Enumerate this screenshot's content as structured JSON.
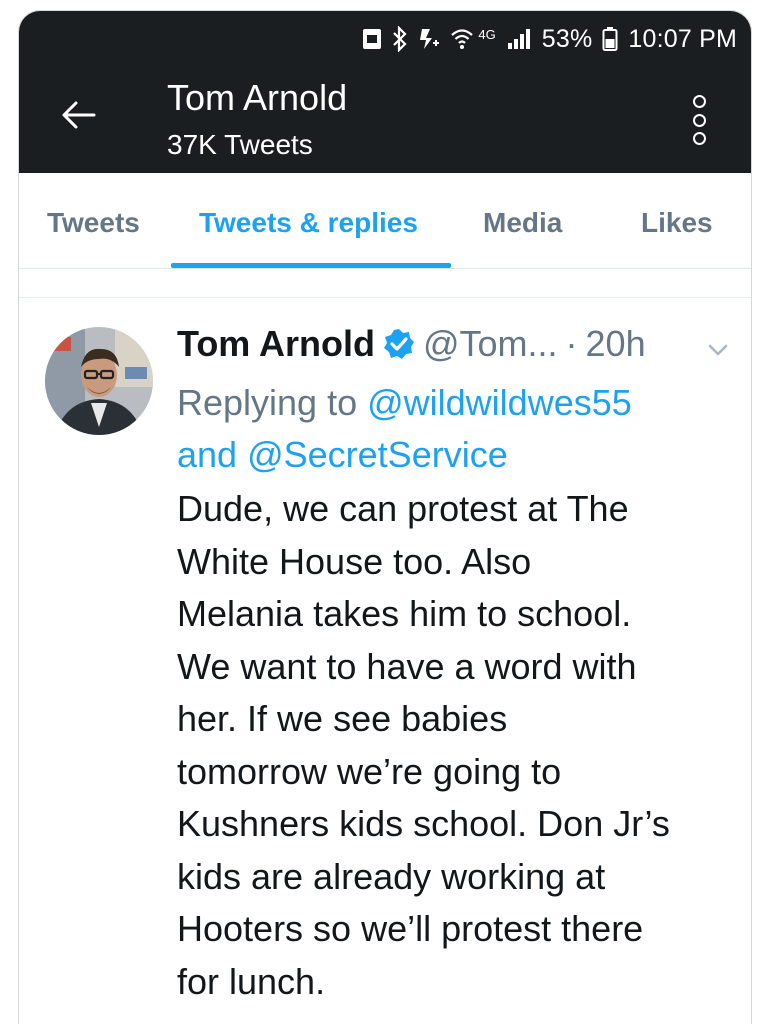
{
  "status_bar": {
    "battery_percent": "53%",
    "time": "10:07 PM",
    "network_label": "4G",
    "icons": [
      "card-icon",
      "bluetooth-icon",
      "nfc-icon",
      "wifi-icon",
      "signal-icon",
      "battery-icon"
    ]
  },
  "header": {
    "title": "Tom Arnold",
    "subtitle": "37K Tweets",
    "back_icon": "back-arrow-icon",
    "more_icon": "more-vertical-icon"
  },
  "tabs": [
    {
      "label": "Tweets",
      "active": false
    },
    {
      "label": "Tweets & replies",
      "active": true
    },
    {
      "label": "Media",
      "active": false
    },
    {
      "label": "Likes",
      "active": false
    }
  ],
  "tweet": {
    "author_name": "Tom Arnold",
    "verified": true,
    "handle": "@Tom...",
    "separator": "·",
    "time": "20h",
    "replying_to_prefix": "Replying to",
    "mention_1": "@wildwildwes55",
    "and_word": "and",
    "mention_2": "@SecretService",
    "text_lines": [
      "Dude, we can protest at The",
      "White House too. Also",
      "Melania takes him to school.",
      "We want to have a word with",
      "her. If we see babies",
      "tomorrow we’re going to",
      "Kushners kids school. Don Jr’s",
      "kids are already working at",
      "Hooters so we’ll protest there",
      "for lunch."
    ]
  },
  "colors": {
    "header_bg": "#1b1e20",
    "accent": "#1da1f2",
    "muted": "#657786",
    "text": "#14171a"
  }
}
